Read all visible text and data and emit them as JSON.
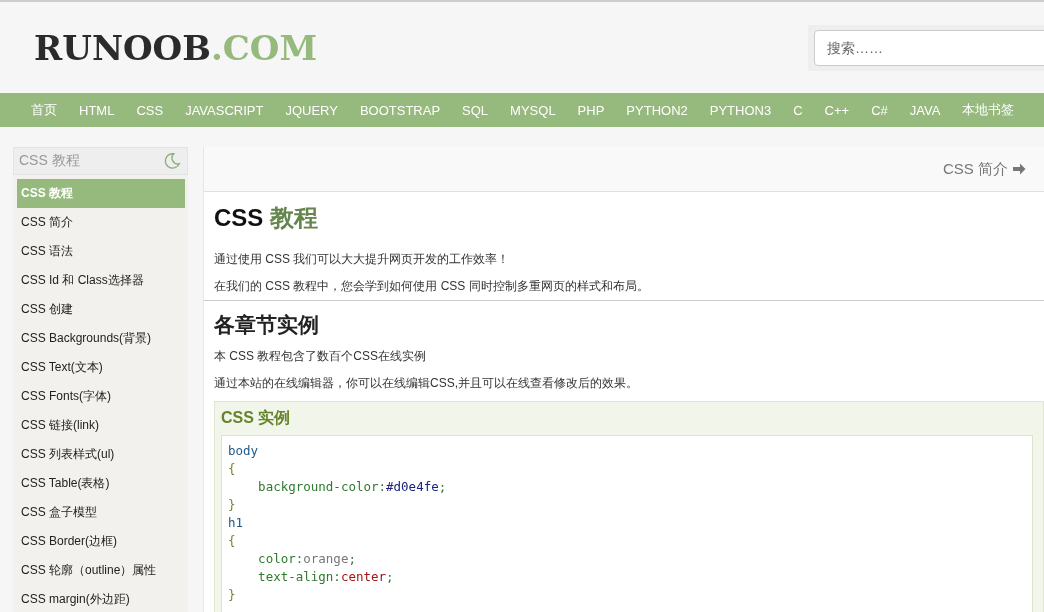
{
  "header": {
    "logo_main": "RUNOOB",
    "logo_suffix": ".COM",
    "search": {
      "placeholder": "搜索……"
    }
  },
  "nav": [
    "首页",
    "HTML",
    "CSS",
    "JAVASCRIPT",
    "JQUERY",
    "BOOTSTRAP",
    "SQL",
    "MYSQL",
    "PHP",
    "PYTHON2",
    "PYTHON3",
    "C",
    "C++",
    "C#",
    "JAVA",
    "本地书签"
  ],
  "sidebar": {
    "title": "CSS 教程",
    "items": [
      {
        "label": "CSS 教程",
        "selected": true
      },
      {
        "label": "CSS 简介",
        "selected": false
      },
      {
        "label": "CSS 语法",
        "selected": false
      },
      {
        "label": "CSS Id 和 Class选择器",
        "selected": false
      },
      {
        "label": "CSS 创建",
        "selected": false
      },
      {
        "label": "CSS Backgrounds(背景)",
        "selected": false
      },
      {
        "label": "CSS Text(文本)",
        "selected": false
      },
      {
        "label": "CSS Fonts(字体)",
        "selected": false
      },
      {
        "label": "CSS 链接(link)",
        "selected": false
      },
      {
        "label": "CSS 列表样式(ul)",
        "selected": false
      },
      {
        "label": "CSS Table(表格)",
        "selected": false
      },
      {
        "label": "CSS 盒子模型",
        "selected": false
      },
      {
        "label": "CSS Border(边框)",
        "selected": false
      },
      {
        "label": "CSS 轮廓（outline）属性",
        "selected": false
      },
      {
        "label": "CSS margin(外边距)",
        "selected": false
      }
    ]
  },
  "main": {
    "next_link": "CSS 简介",
    "title_main": "CSS",
    "title_accent": "教程",
    "intro": [
      "通过使用 CSS 我们可以大大提升网页开发的工作效率！",
      "在我们的 CSS 教程中，您会学到如何使用 CSS 同时控制多重网页的样式和布局。"
    ],
    "section_title": "各章节实例",
    "section_paragraphs": [
      "本 CSS 教程包含了数百个CSS在线实例",
      "通过本站的在线编辑器，你可以在线编辑CSS,并且可以在线查看修改后的效果。"
    ],
    "example": {
      "title": "CSS 实例",
      "lines": [
        [
          {
            "text": "body",
            "kind": "selector"
          }
        ],
        [
          {
            "text": "{",
            "kind": "brace"
          }
        ],
        [
          {
            "text": "    background-color:",
            "kind": "property"
          },
          {
            "text": "#d0e4fe",
            "kind": "hex"
          },
          {
            "text": ";",
            "kind": "property"
          }
        ],
        [
          {
            "text": "}",
            "kind": "brace"
          }
        ],
        [
          {
            "text": "h1",
            "kind": "selector"
          }
        ],
        [
          {
            "text": "{",
            "kind": "brace"
          }
        ],
        [
          {
            "text": "    color:",
            "kind": "property"
          },
          {
            "text": "orange",
            "kind": "keyword"
          },
          {
            "text": ";",
            "kind": "property"
          }
        ],
        [
          {
            "text": "    text-align:",
            "kind": "property"
          },
          {
            "text": "center",
            "kind": "value"
          },
          {
            "text": ";",
            "kind": "property"
          }
        ],
        [
          {
            "text": "}",
            "kind": "brace"
          }
        ]
      ]
    }
  }
}
